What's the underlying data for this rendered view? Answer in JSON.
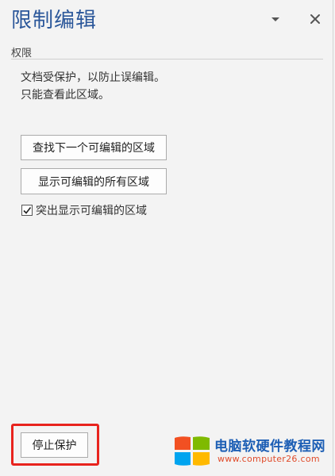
{
  "pane": {
    "title": "限制编辑",
    "menu_icon": "chevron-down-icon",
    "close_icon": "close-icon"
  },
  "permissions": {
    "section_label": "权限",
    "description_line1": "文档受保护，以防止误编辑。",
    "description_line2": "只能查看此区域。",
    "find_next_label": "查找下一个可编辑的区域",
    "show_all_label": "显示可编辑的所有区域",
    "highlight_label": "突出显示可编辑的区域",
    "highlight_checked": true
  },
  "footer": {
    "stop_protection_label": "停止保护"
  },
  "watermark": {
    "title": "电脑软硬件教程网",
    "url": "www.computer26.com"
  },
  "colors": {
    "title": "#2b579a",
    "highlight_border": "#e8231d",
    "watermark_title": "#1d5fb5",
    "watermark_url": "#e04c2b"
  }
}
